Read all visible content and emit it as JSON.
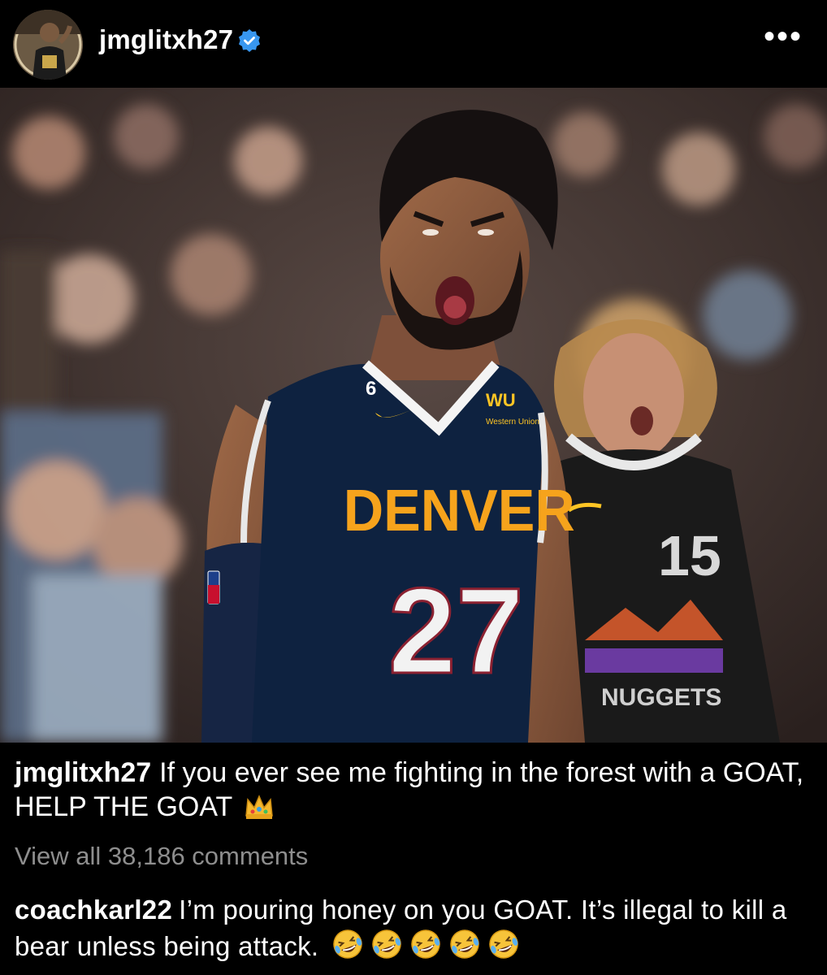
{
  "post": {
    "username": "jmglitxh27",
    "verified_icon": "verified-badge-icon",
    "more_label": "•••",
    "caption_user": "jmglitxh27",
    "caption_text": "If you ever see me fighting in the forest with a GOAT, HELP THE GOAT",
    "caption_emoji": "crown-emoji",
    "view_all": "View all 38,186 comments"
  },
  "photo": {
    "jersey_text": "DENVER",
    "jersey_number": "27",
    "patch_number": "6",
    "sponsor": "WU",
    "sponsor_sub": "Western Union",
    "fan_jersey_number": "15",
    "fan_jersey_text": "NUGGETS"
  },
  "comment": {
    "user": "coachkarl22",
    "text": "I’m pouring honey on you GOAT. It’s illegal to kill a bear unless being attack.",
    "emoji": "rolling-laughing-emoji",
    "emoji_count": 5
  },
  "colors": {
    "background": "#000000",
    "verified_blue": "#3897f0",
    "muted_text": "#8e8e8e",
    "jersey_navy": "#0e2240",
    "jersey_gold": "#fec524"
  }
}
